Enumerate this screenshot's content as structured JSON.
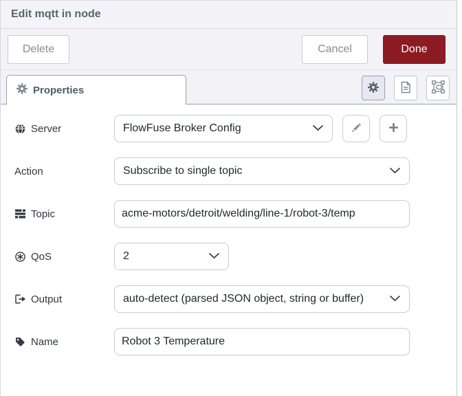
{
  "header": {
    "title": "Edit mqtt in node"
  },
  "toolbar": {
    "delete_label": "Delete",
    "cancel_label": "Cancel",
    "done_label": "Done"
  },
  "tabs": {
    "properties_label": "Properties"
  },
  "form": {
    "server": {
      "label": "Server",
      "value": "FlowFuse Broker Config"
    },
    "action": {
      "label": "Action",
      "value": "Subscribe to single topic"
    },
    "topic": {
      "label": "Topic",
      "value": "acme-motors/detroit/welding/line-1/robot-3/temp"
    },
    "qos": {
      "label": "QoS",
      "value": "2"
    },
    "output": {
      "label": "Output",
      "value": "auto-detect (parsed JSON object, string or buffer)"
    },
    "name": {
      "label": "Name",
      "value": "Robot 3 Temperature"
    }
  },
  "icons": {
    "title_bar": [],
    "tab": "gear-icon",
    "pane_buttons": [
      "gear-icon",
      "document-icon",
      "appearance-frame-icon"
    ],
    "server_label": "globe-icon",
    "topic_label": "tasks-icon",
    "qos_label": "circled-asterisk-icon",
    "output_label": "sign-out-icon",
    "name_label": "tag-icon",
    "server_extra_buttons": [
      "pencil-icon",
      "plus-icon"
    ],
    "selects": "chevron-down-icon"
  },
  "colors": {
    "done_button_bg": "#8c1b23",
    "header_bg": "#f4f4f8",
    "title_text": "#53676d",
    "active_pane_btn_bg": "#e7e8f3",
    "input_border": "#c9cbd4"
  }
}
